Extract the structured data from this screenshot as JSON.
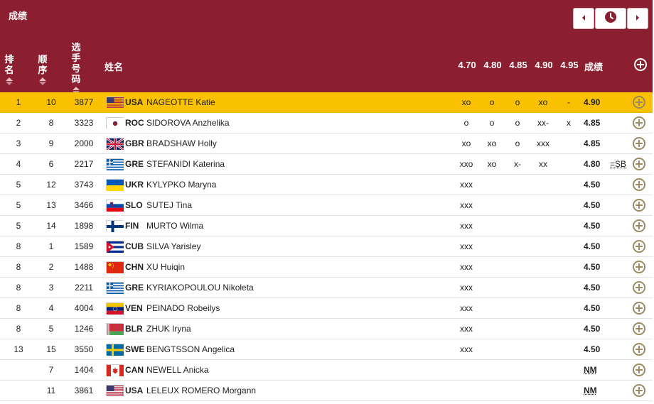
{
  "header": {
    "title": "成绩",
    "rank_label": [
      "排",
      "名"
    ],
    "order_label": [
      "顺",
      "序"
    ],
    "bib_label": [
      "选",
      "手",
      "号",
      "码"
    ],
    "name_label": "姓名",
    "heights": [
      "4.70",
      "4.80",
      "4.85",
      "4.90",
      "4.95"
    ],
    "mark_label": "成绩",
    "icons": [
      "prev-arrow-icon",
      "clock-icon",
      "next-arrow-icon",
      "add-icon"
    ],
    "colors": {
      "accent": "#8b1f2f",
      "highlight": "#f9c100"
    }
  },
  "rows": [
    {
      "rank": "1",
      "order": "10",
      "bib": "3877",
      "country": "USA",
      "athlete": "NAGEOTTE Katie",
      "attempts": [
        "xo",
        "o",
        "o",
        "xo",
        "-"
      ],
      "mark": "4.90",
      "note": "",
      "highlight": true
    },
    {
      "rank": "2",
      "order": "8",
      "bib": "3323",
      "country": "ROC",
      "athlete": "SIDOROVA Anzhelika",
      "attempts": [
        "o",
        "o",
        "o",
        "xx-",
        "x"
      ],
      "mark": "4.85",
      "note": ""
    },
    {
      "rank": "3",
      "order": "9",
      "bib": "2000",
      "country": "GBR",
      "athlete": "BRADSHAW Holly",
      "attempts": [
        "xo",
        "xo",
        "o",
        "xxx",
        ""
      ],
      "mark": "4.85",
      "note": ""
    },
    {
      "rank": "4",
      "order": "6",
      "bib": "2217",
      "country": "GRE",
      "athlete": "STEFANIDI Katerina",
      "attempts": [
        "xxo",
        "xo",
        "x-",
        "xx",
        ""
      ],
      "mark": "4.80",
      "note": "=SB"
    },
    {
      "rank": "5",
      "order": "12",
      "bib": "3743",
      "country": "UKR",
      "athlete": "KYLYPKO Maryna",
      "attempts": [
        "xxx",
        "",
        "",
        "",
        ""
      ],
      "mark": "4.50",
      "note": ""
    },
    {
      "rank": "5",
      "order": "13",
      "bib": "3466",
      "country": "SLO",
      "athlete": "SUTEJ Tina",
      "attempts": [
        "xxx",
        "",
        "",
        "",
        ""
      ],
      "mark": "4.50",
      "note": ""
    },
    {
      "rank": "5",
      "order": "14",
      "bib": "1898",
      "country": "FIN",
      "athlete": "MURTO Wilma",
      "attempts": [
        "xxx",
        "",
        "",
        "",
        ""
      ],
      "mark": "4.50",
      "note": ""
    },
    {
      "rank": "8",
      "order": "1",
      "bib": "1589",
      "country": "CUB",
      "athlete": "SILVA Yarisley",
      "attempts": [
        "xxx",
        "",
        "",
        "",
        ""
      ],
      "mark": "4.50",
      "note": ""
    },
    {
      "rank": "8",
      "order": "2",
      "bib": "1488",
      "country": "CHN",
      "athlete": "XU Huiqin",
      "attempts": [
        "xxx",
        "",
        "",
        "",
        ""
      ],
      "mark": "4.50",
      "note": ""
    },
    {
      "rank": "8",
      "order": "3",
      "bib": "2211",
      "country": "GRE",
      "athlete": "KYRIAKOPOULOU Nikoleta",
      "attempts": [
        "xxx",
        "",
        "",
        "",
        ""
      ],
      "mark": "4.50",
      "note": ""
    },
    {
      "rank": "8",
      "order": "4",
      "bib": "4004",
      "country": "VEN",
      "athlete": "PEINADO Robeilys",
      "attempts": [
        "xxx",
        "",
        "",
        "",
        ""
      ],
      "mark": "4.50",
      "note": ""
    },
    {
      "rank": "8",
      "order": "5",
      "bib": "1246",
      "country": "BLR",
      "athlete": "ZHUK Iryna",
      "attempts": [
        "xxx",
        "",
        "",
        "",
        ""
      ],
      "mark": "4.50",
      "note": ""
    },
    {
      "rank": "13",
      "order": "15",
      "bib": "3550",
      "country": "SWE",
      "athlete": "BENGTSSON Angelica",
      "attempts": [
        "xxx",
        "",
        "",
        "",
        ""
      ],
      "mark": "4.50",
      "note": ""
    },
    {
      "rank": "",
      "order": "7",
      "bib": "1404",
      "country": "CAN",
      "athlete": "NEWELL Anicka",
      "attempts": [
        "",
        "",
        "",
        "",
        ""
      ],
      "mark": "NM",
      "note": ""
    },
    {
      "rank": "",
      "order": "11",
      "bib": "3861",
      "country": "USA",
      "athlete": "LELEUX ROMERO Morgann",
      "attempts": [
        "",
        "",
        "",
        "",
        ""
      ],
      "mark": "NM",
      "note": ""
    }
  ]
}
